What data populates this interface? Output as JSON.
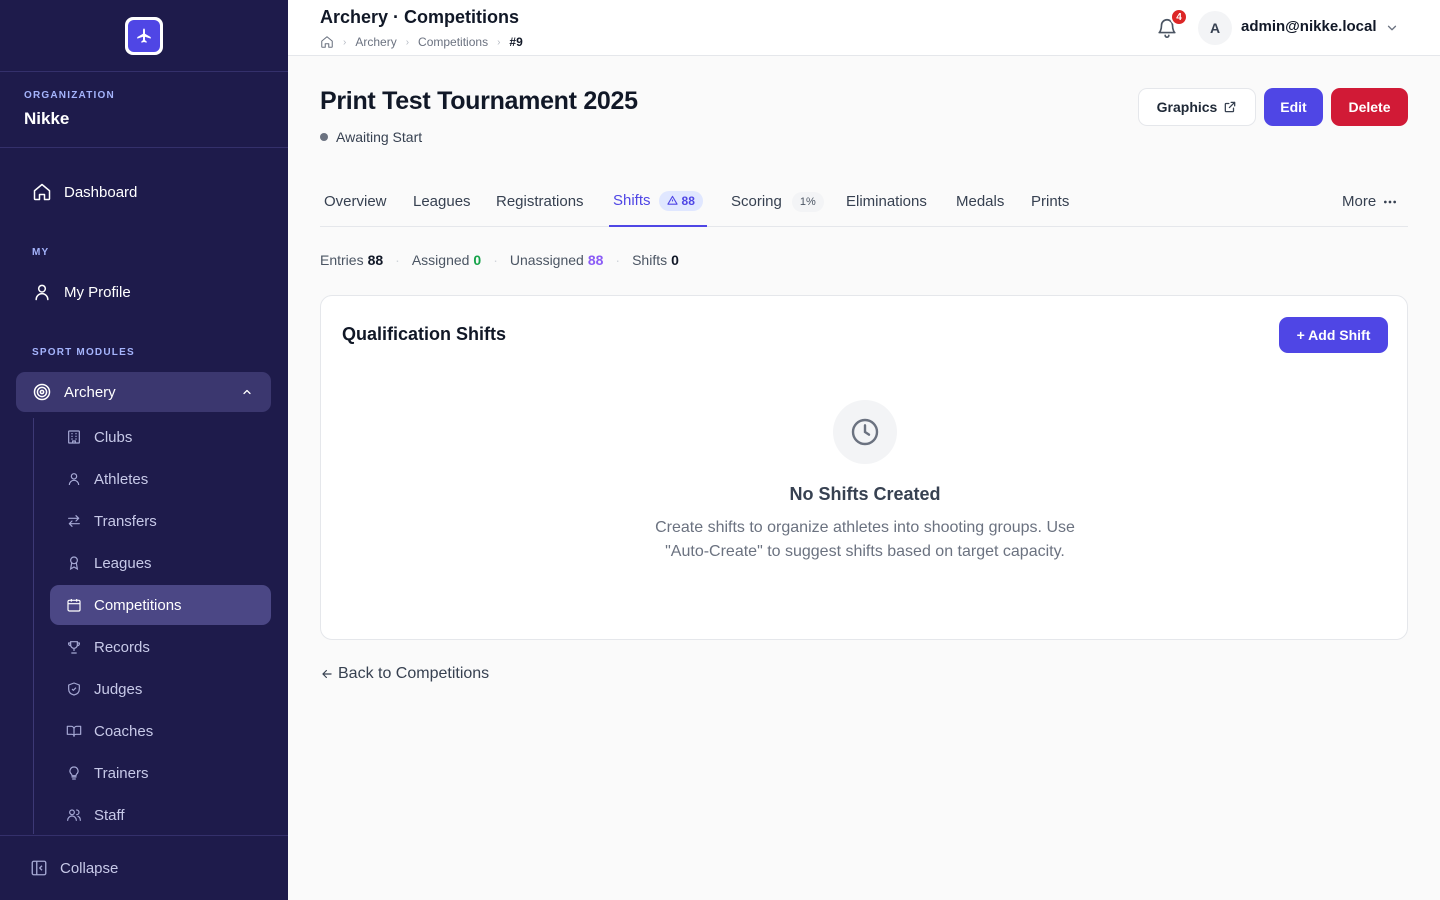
{
  "sidebar": {
    "org_label": "ORGANIZATION",
    "org_name": "Nikke",
    "dashboard": "Dashboard",
    "my_label": "MY",
    "my_profile": "My Profile",
    "sport_label": "SPORT MODULES",
    "archery": "Archery",
    "items": {
      "clubs": "Clubs",
      "athletes": "Athletes",
      "transfers": "Transfers",
      "leagues": "Leagues",
      "competitions": "Competitions",
      "records": "Records",
      "judges": "Judges",
      "coaches": "Coaches",
      "trainers": "Trainers",
      "staff": "Staff"
    },
    "collapse": "Collapse"
  },
  "header": {
    "title": "Archery · Competitions",
    "breadcrumb": [
      "Archery",
      "Competitions",
      "#9"
    ],
    "notification_count": "4",
    "avatar_initial": "A",
    "user_email": "admin@nikke.local"
  },
  "page": {
    "title": "Print Test Tournament 2025",
    "status": "Awaiting Start",
    "actions": {
      "graphics": "Graphics",
      "edit": "Edit",
      "delete": "Delete"
    }
  },
  "tabs": {
    "overview": "Overview",
    "leagues": "Leagues",
    "registrations": "Registrations",
    "shifts": "Shifts",
    "shifts_badge": "88",
    "scoring": "Scoring",
    "scoring_badge": "1%",
    "eliminations": "Eliminations",
    "medals": "Medals",
    "prints": "Prints",
    "more": "More"
  },
  "stats": {
    "entries_label": "Entries",
    "entries": "88",
    "assigned_label": "Assigned",
    "assigned": "0",
    "unassigned_label": "Unassigned",
    "unassigned": "88",
    "shifts_label": "Shifts",
    "shifts": "0"
  },
  "card": {
    "title": "Qualification Shifts",
    "add_button": "+ Add Shift",
    "empty_title": "No Shifts Created",
    "empty_desc": "Create shifts to organize athletes into shooting groups. Use \"Auto-Create\" to suggest shifts based on target capacity."
  },
  "back_link": "Back to Competitions",
  "colors": {
    "sidebar_bg": "#1e1b4b",
    "primary": "#4f46e5",
    "danger": "#d11a36",
    "success": "#16a34a",
    "unassigned": "#8b5cf6"
  }
}
